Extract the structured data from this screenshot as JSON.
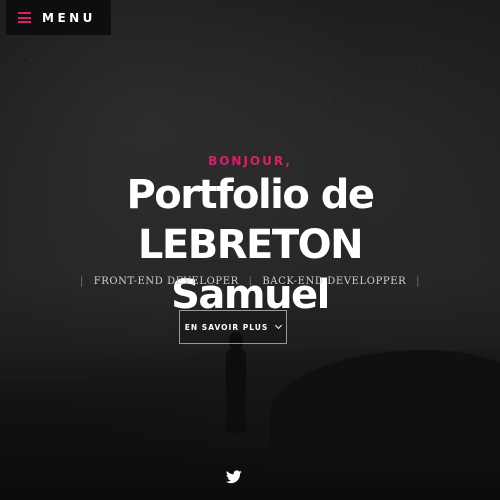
{
  "nav": {
    "menu_label": "MENU",
    "menu_icon": "hamburger-icon",
    "accent_color": "#d6206b"
  },
  "hero": {
    "greeting": "BONJOUR,",
    "title_line1": "Portfolio de LEBRETON",
    "title_line2": "Samuel",
    "roles": [
      "FRONT-END DEVELOPER",
      "BACK-END DEVELOPPER"
    ],
    "separator": "|",
    "cta_label": "EN SAVOIR PLUS",
    "cta_icon": "chevron-down-icon"
  },
  "social": {
    "icon": "twitter-icon"
  }
}
